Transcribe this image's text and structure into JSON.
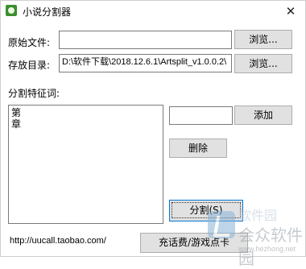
{
  "window": {
    "title": "小说分割器",
    "close_glyph": "✕"
  },
  "source": {
    "label": "原始文件:",
    "value": "",
    "browse_label": "浏览..."
  },
  "save": {
    "label": "存放目录:",
    "value": "D:\\软件下载\\2018.12.6.1\\Artsplit_v1.0.0.2\\",
    "browse_label": "浏览..."
  },
  "features": {
    "label": "分割特征词:",
    "lines": [
      "第",
      "章"
    ],
    "new_word_value": "",
    "add_label": "添加",
    "delete_label": "删除"
  },
  "split_label": "分割(S)",
  "footer": {
    "url": "http://uucall.taobao.com/",
    "recharge_label": "充话费/游戏点卡"
  },
  "watermark": {
    "top": "软件园",
    "name": "会众软件园",
    "url": "www.hezhong.net"
  }
}
